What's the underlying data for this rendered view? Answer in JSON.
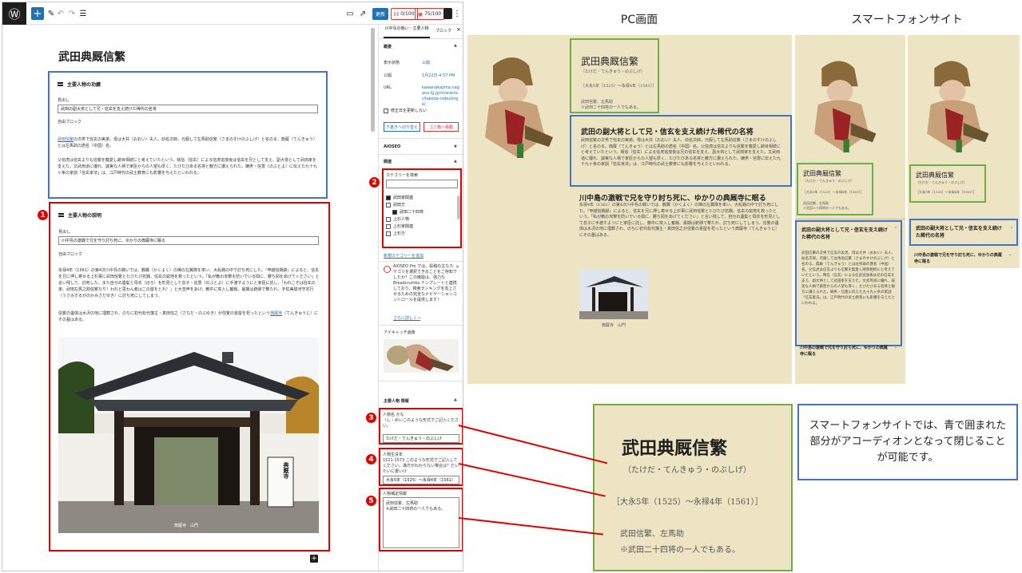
{
  "editor": {
    "toolbar": {
      "save_label": "更新",
      "seo_score_a": "0/100",
      "seo_score_b": "75/100"
    },
    "post_title": "武田典厩信繁",
    "block1": {
      "heading": "主要人物の功績",
      "caption_label": "見出し",
      "caption_value": "武田の副大将として兄・信玄を支え続けた稀代の名将",
      "free_block_label": "自由ブロック",
      "para1_link": "武田信繁",
      "para1": "の次男で信玄の実弟。母は大井（おおい）夫人。幼名次郎。元服して左馬助信繁（さまのすけのぶしげ）と名のる。典厩（てんきゅう）とは左馬助の唐名（中国）名。",
      "para2": "父信虎は信玄よりも信繁を寵愛し跡目相続にと考えていたという。晴信（信玄）による信虎追放後は信玄を兄として支え、副大将として武田家を支えた。文武両道に優れ、誠実な人柄で家臣からの人望も厚く、たびたびある名将と敵方に讃えられた。嫡男・信豊（のぶとよ）に伝えた九十九ヶ条の家訓「信玄家法」は、江戸時代の武士教育にも影響を与えたといわれる。"
    },
    "block2": {
      "heading": "主要人物の説明",
      "caption_label": "見出し",
      "caption_value": "川中島の激戦で兄を守り討ち死に。ゆかりの典厩寺に眠る",
      "free_block_label": "自由ブロック",
      "para1": "永禄4年（1561）の第4次川中島の戦いでは、鶴翼（かくよく）の陣の左翼隊を率い、大乱戦の中で討ち死にした。『甲越信戦録』によると、信玄を兄に押し寄せる上杉軍に武田信繁とたびたび抗戦、信玄の窮地を救ったという。「私が敵の攻撃を防いでいる間に、勝ち鬨をあげてください」と言い残して、討死した。また自分の遺髪と母衣（ほろ）を形見として息子・信豊（のぶとよ）に手渡すようにと家臣に託し、「われこそは信玄の弟、武田左馬之助信繁なり！われと思わん者はこの首をとれ！」と大音声をあげ、敵中に突入し奮戦、最期は銃弾で撃たれ、字佐美駿河守定行（うさみするがのかみさだゆき）に討ち死にしてしまう。",
      "para2_pre": "信繁の遺体は水沢の地に埋葬され、のちに初代松代藩主・真田信之（さなだ・のぶゆき）が信繁の霊屋を祀ったという",
      "para2_link": "典厩寺",
      "para2_post": "（てんきゅうじ）にその墓はある。",
      "photo_caption": "典厩寺　山門",
      "sign_text": "典厩寺"
    }
  },
  "sidebar": {
    "tabs": [
      "川中島の戦い・主要人物",
      "ブロック"
    ],
    "summary_title": "概要",
    "visibility_label": "表示状態",
    "visibility_value": "公開",
    "publish_label": "公開",
    "publish_value": "1月22日 4:57 PM",
    "url_label": "URL",
    "url_value": "kawanakajima.nagano.lg.jp/character/takeda-nobushige/",
    "sticky_label": "修正日を更新しない",
    "draft_button": "下書きへ切り替え",
    "trash_button": "ゴミ箱へ移動",
    "aioseo_label": "AIOSEO",
    "category_section": "関連",
    "category_search_label": "カテゴリーを検索",
    "categories": [
      {
        "label": "武田家関連",
        "checked": true
      },
      {
        "label": "武田方",
        "checked": false
      },
      {
        "label": "武田二十四将",
        "checked": true
      },
      {
        "label": "上杉人物",
        "checked": false
      },
      {
        "label": "上杉家関連",
        "checked": false
      },
      {
        "label": "上杉方",
        "checked": false
      }
    ],
    "add_category_link": "新規カテゴリーを追加",
    "aioseo_notice": "AIOSEO Pro では、投稿の主なカテゴリを選択できることをご存知でしたか？この機能は、強力なBreadcrumbs テンプレートと連携しており、検索ランキングを向上させるための完全なナビゲーションコントロールを提供します！",
    "learn_more": "さらに詳しく→",
    "featured_image_label": "アイキャッチ画像",
    "info_section": "主要人物 情報",
    "field3_label": "人物名 かな",
    "field3_help": "（し・めいこのような形式でご記入ください。",
    "field3_value": "たけだ・てんきゅう・のぶしげ",
    "field4_label": "人物生没年",
    "field4_help": "1521-1573 このような形式でご記入してください。満方がわからない場合は？だいたいに書いけ",
    "field4_value": "大永5年（1525）～永禄4年（1561）",
    "field5_label": "人物補足情報",
    "field5_value_line1": "武田信繁、左馬助",
    "field5_value_line2": "※武田二十四将の一人でもある。"
  },
  "markers": [
    "1",
    "2",
    "3",
    "4",
    "5"
  ],
  "pc": {
    "label": "PC画面",
    "name": "武田典厩信繁",
    "kana": "（たけだ・てんきゅう・のぶしげ）",
    "years": "［大永5年（1525）～永禄4年（1561）］",
    "note1": "武田信繁、左馬助",
    "note2": "※武田二十四将の一人でもある。",
    "h1": "武田の副大将として兄・信玄を支え続けた稀代の名将",
    "h1_body": "武田信繁の次男で信玄の実弟。母は大井（おおい）夫人。幼名次郎。元服して左馬助信繁（さまのすけのぶしげ）と名のる。典厩（てんきゅう）とは左馬助の唐名（中国）名。父信虎は信玄よりも信繁を寵愛し跡目相続にと考えていたという。晴信（信玄）による信虎追放後は兄の信玄を支え、副大将として武田家を支えた。文武両道に優れ、誠実な人柄で家臣からの人望も厚く、たびたびある名将と敵方に讃えられた。嫡男・信豊に伝えた九十九ヶ条の家訓「信玄家法」は、江戸時代の武士教育にも影響を与えたといわれる。",
    "h2": "川中島の激戦で兄を守り討ち死に、ゆかりの典厩寺に眠る",
    "h2_body": "永禄4年（1561）の第4次川中島の戦いでは、鶴翼（かくよく）の陣の左翼隊を率い、大乱戦の中で討ち死にした。『甲越信戦録』によると、信玄を兄に押し寄せる上杉軍に武田信繁とたびたび抗戦、信玄の窮地を救ったという。「私が敵の攻撃を防いでいる間に、勝ち鬨をあげてください」と言い残して、自分の遺髪と母衣を形見として息子に手渡すようにと家臣に託し、敵中に突入し奮戦、最期は銃弾で撃たれ、討ち死にしてしまう。信繁の遺体は水沢の地に埋葬され、のちに初代松代藩主・真田信之が信繁の霊屋を祀ったという典厩寺（てんきゅうじ）にその墓はある。",
    "photo_caption": "典厩寺　山門"
  },
  "sp": {
    "label": "スマートフォンサイト",
    "name": "武田典厩信繁",
    "kana": "（たけだ・てんきゅう・のぶしげ）",
    "years": "［大永5年（1525）～永禄4年（1561）］",
    "note1": "武田信繁、左馬助",
    "note2": "※武田二十四将の一人でもある。",
    "h1": "武田の副大将として兄・信玄を支え続けた稀代の名将",
    "h1_body": "武田信繁の次男で信玄の実弟。母は大井（おおい）夫人。幼名次郎。元服して左馬助信繁（さまのすけのぶしげ）と名のる。典厩（てんきゅう）とは左馬助の唐名（中国）名。父信虎は信玄よりも信繁を寵愛し跡目相続にと考えていたという。晴信（信玄）による信虎追放後は兄の信玄を支え、副大将として武田家を支えた。文武両道に優れ、誠実な人柄で家臣からの人望も厚く、たびたびある名将と敵方に讃えられた。嫡男・信豊に伝えた九十九ヶ条の家訓「信玄家法」は、江戸時代の武士教育にも影響を与えたといわれる。",
    "h2": "川中島の激戦で兄を守り討ち死に、ゆかりの典厩寺に眠る"
  },
  "zoom": {
    "name": "武田典厩信繁",
    "kana": "（たけだ・てんきゅう・のぶしげ）",
    "years": "［大永5年（1525）～永禄4年（1561）］",
    "note1": "武田信繁、左馬助",
    "note2": "※武田二十四将の一人でもある。"
  },
  "explanation": "スマートフォンサイトでは、青で囲まれた部分がアコーディオンとなって閉じることが可能です。",
  "colors": {
    "blue": "#4472c4",
    "red": "#e00000",
    "green": "#70ad47",
    "beige": "#ede4c4",
    "wp_blue": "#2271b1"
  }
}
